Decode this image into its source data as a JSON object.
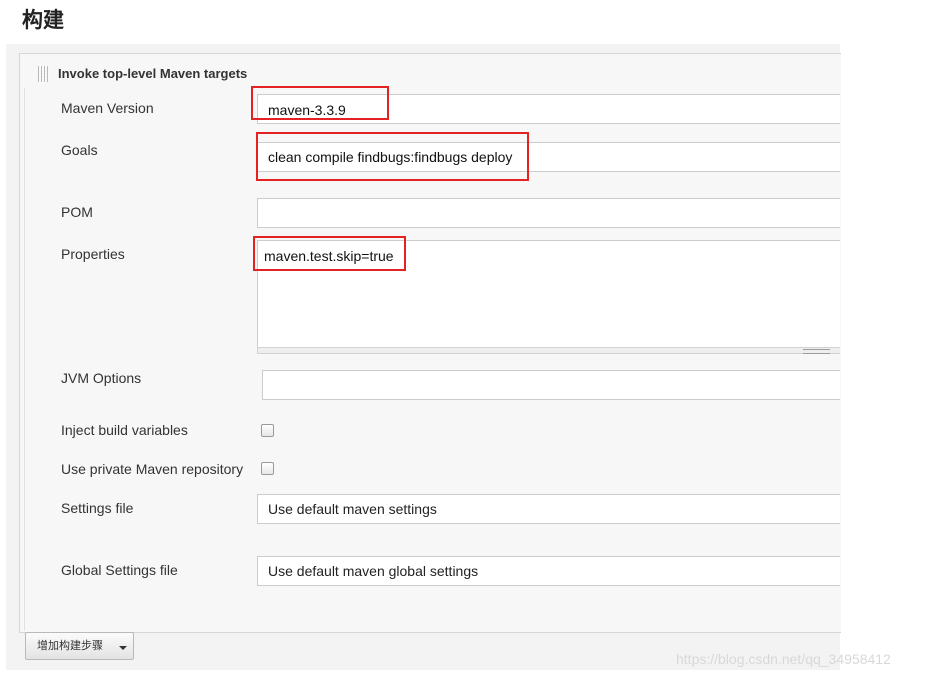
{
  "page_title": "构建",
  "build_step": {
    "title": "Invoke top-level Maven targets",
    "fields": {
      "maven_version": {
        "label": "Maven Version",
        "value": "maven-3.3.9"
      },
      "goals": {
        "label": "Goals",
        "value": "clean compile findbugs:findbugs deploy"
      },
      "pom": {
        "label": "POM",
        "value": ""
      },
      "properties": {
        "label": "Properties",
        "value": "maven.test.skip=true"
      },
      "jvm_options": {
        "label": "JVM Options",
        "value": ""
      },
      "inject_build_variables": {
        "label": "Inject build variables",
        "checked": false
      },
      "use_private_repo": {
        "label": "Use private Maven repository",
        "checked": false
      },
      "settings_file": {
        "label": "Settings file",
        "value": "Use default maven settings"
      },
      "global_settings_file": {
        "label": "Global Settings file",
        "value": "Use default maven global settings"
      }
    }
  },
  "add_step_button": {
    "label": "增加构建步骤"
  },
  "watermark": "https://blog.csdn.net/qq_34958412",
  "colors": {
    "highlight": "#e52222",
    "panel": "#f7f7f7",
    "border": "#cccccc"
  }
}
